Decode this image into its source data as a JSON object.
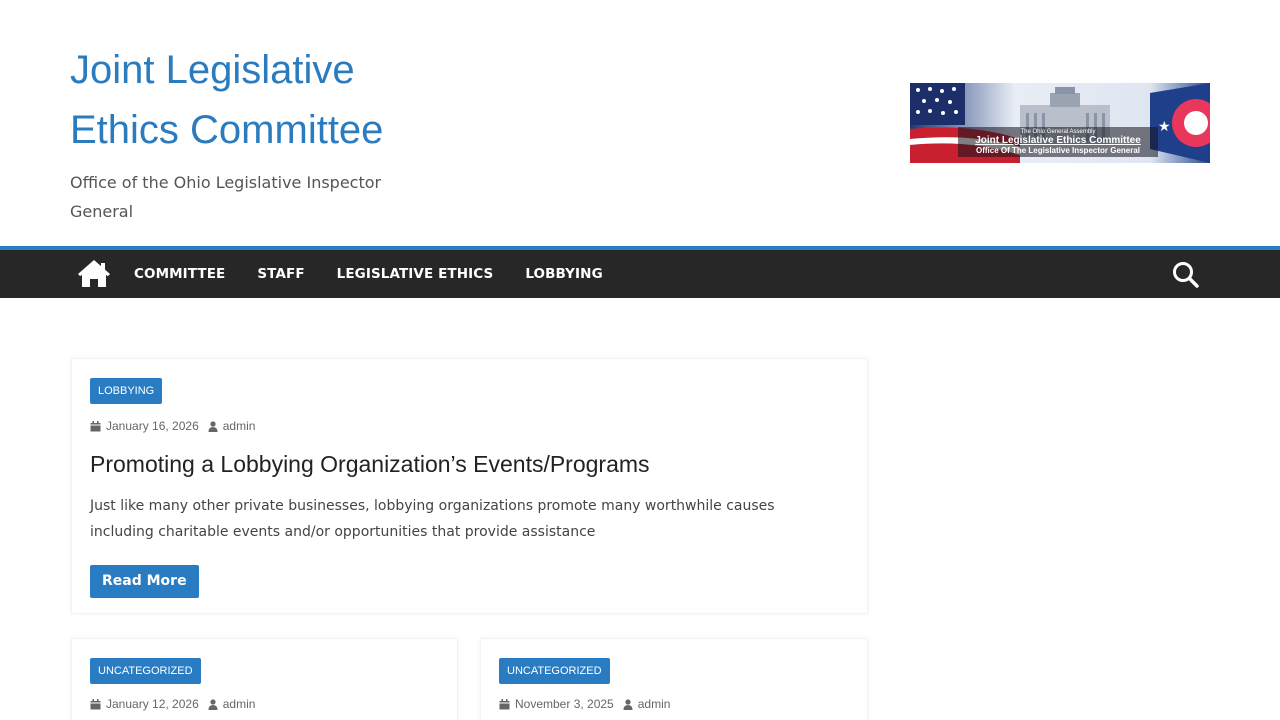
{
  "site": {
    "title_line1": "Joint Legislative",
    "title_line2": "Ethics Committee",
    "description": "Office of the Ohio Legislative Inspector General",
    "banner": {
      "line1": "The Ohio General Assembly",
      "line2": "Joint Legislative Ethics Committee",
      "line3": "Office Of The Legislative Inspector General"
    }
  },
  "nav": {
    "items": [
      "COMMITTEE",
      "STAFF",
      "LEGISLATIVE ETHICS",
      "LOBBYING"
    ]
  },
  "posts": {
    "featured": {
      "category": "LOBBYING",
      "date": "January 16, 2026",
      "author": "admin",
      "title": "Promoting a Lobbying Organization’s Events/Programs",
      "excerpt": "Just like many other private businesses, lobbying organizations promote many worthwhile causes including charitable events and/or opportunities that provide assistance",
      "read_more": "Read More"
    },
    "second": {
      "category": "UNCATEGORIZED",
      "date": "January 12, 2026",
      "author": "admin"
    },
    "third": {
      "category": "UNCATEGORIZED",
      "date": "November 3, 2025",
      "author": "admin"
    }
  },
  "colors": {
    "accent": "#2a7cc2",
    "nav_bg": "#272727",
    "title": "#2b7bbf"
  }
}
